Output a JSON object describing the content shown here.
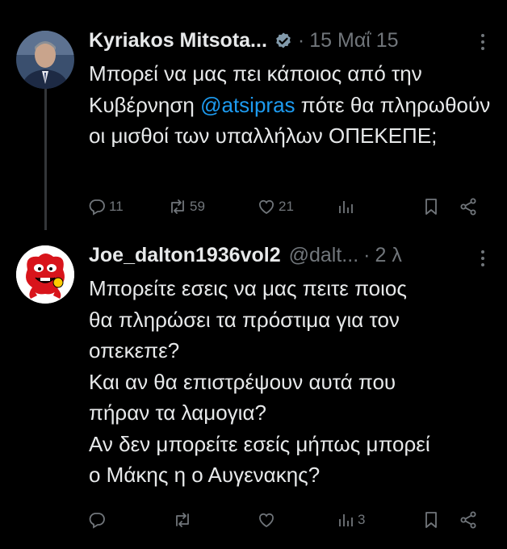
{
  "tweets": [
    {
      "name": "Kyriakos Mitsota...",
      "date": "15 Μαΐ 15",
      "text_before": "Μπορεί να μας πει κάποιος από την Κυβέρνηση ",
      "mention": "@atsipras",
      "text_after": " πότε θα πληρωθούν οι μισθοί των υπαλλήλων ΟΠΕΚΕΠΕ;",
      "replies": "11",
      "retweets": "59",
      "likes": "21",
      "views": ""
    },
    {
      "name": "Joe_dalton1936vol2",
      "handle": "@dalt...",
      "date": "2 λ",
      "lines": [
        "Μπορείτε εσεις να μας πειτε ποιος",
        "θα πληρώσει τα πρόστιμα για τον",
        "οπεκεπε?",
        "Και αν θα επιστρέψουν αυτά που",
        "πήραν τα λαμογια?",
        "Αν δεν μπορείτε εσείς μήπως μπορεί",
        "ο Μάκης η ο Αυγενακης?"
      ],
      "replies": "",
      "retweets": "",
      "likes": "",
      "views": "3"
    }
  ],
  "dot_separator": "·",
  "colors": {
    "background": "#000000",
    "text": "#e7e9ea",
    "muted": "#71767b",
    "link": "#1d9bf0",
    "verified": "#829aab"
  }
}
